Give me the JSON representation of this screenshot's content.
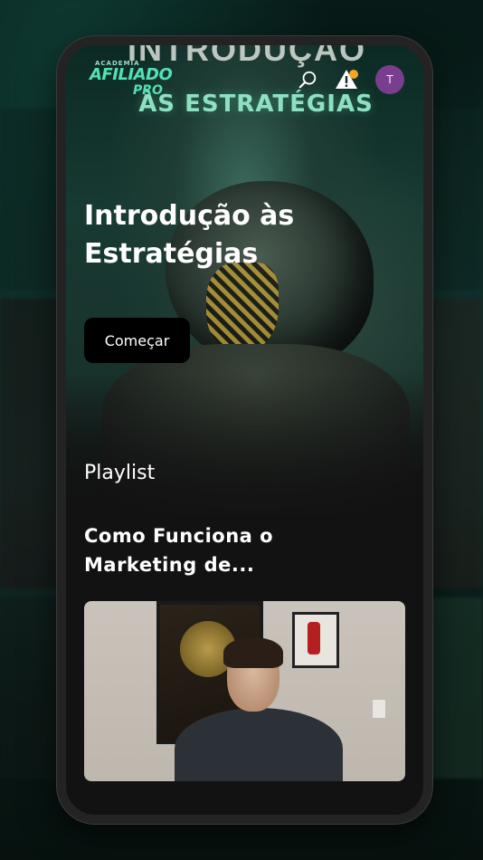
{
  "app": {
    "logo_small": "ACADEMIA",
    "logo_main": "AFILIADO",
    "logo_sub": "PRO"
  },
  "header": {
    "icons": [
      "search-icon",
      "alert-icon",
      "avatar"
    ],
    "avatar_initial": "T",
    "alert_badge_color": "#f5a623"
  },
  "hero": {
    "art_title_top": "INTRODUÇÃO",
    "art_title": "ÀS ESTRATÉGIAS",
    "heading": "Introdução às Estratégias",
    "start_label": "Começar"
  },
  "playlist": {
    "label": "Playlist",
    "episode_title": "Como Funciona o Marketing de..."
  },
  "colors": {
    "accent": "#54e0b4",
    "avatar_bg": "#7a3e8f",
    "screen_bg": "#121212"
  }
}
